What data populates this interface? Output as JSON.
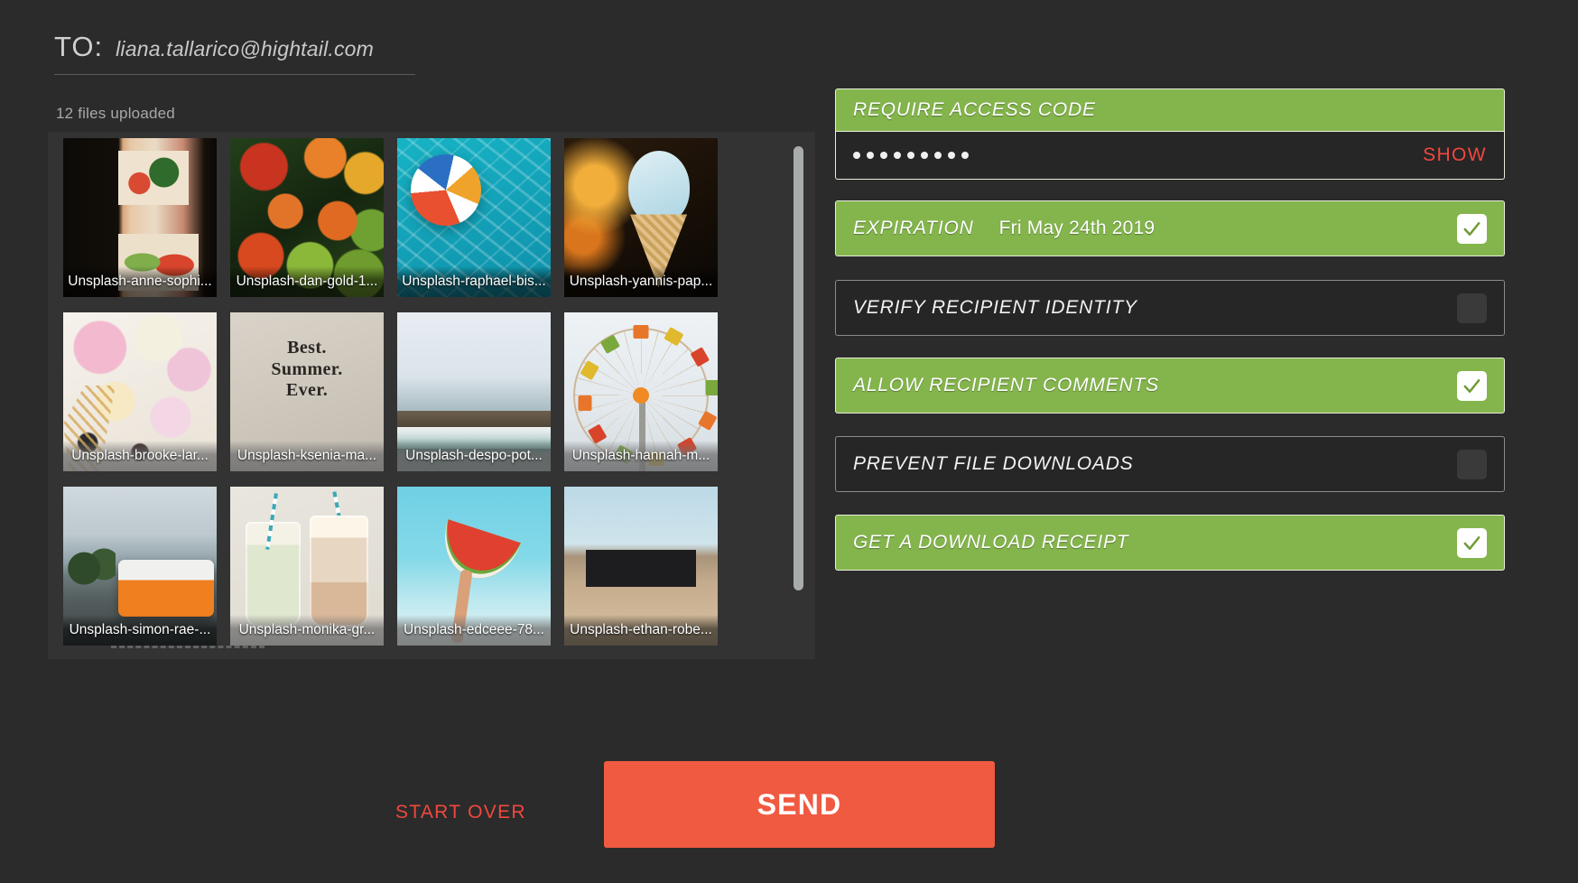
{
  "recipient": {
    "label": "TO:",
    "email": "liana.tallarico@hightail.com"
  },
  "files": {
    "count_text": "12 files uploaded",
    "rows": [
      [
        {
          "caption": "Unsplash-anne-sophi...",
          "art": "a1",
          "tone": "dark"
        },
        {
          "caption": "Unsplash-dan-gold-1...",
          "art": "a2",
          "tone": "dark"
        },
        {
          "caption": "Unsplash-raphael-bis...",
          "art": "a3",
          "tone": "dark"
        },
        {
          "caption": "Unsplash-yannis-pap...",
          "art": "a4",
          "tone": "dark"
        }
      ],
      [
        {
          "caption": "Unsplash-brooke-lar...",
          "art": "a5",
          "tone": "light"
        },
        {
          "caption": "Unsplash-ksenia-ma...",
          "art": "a6",
          "tone": "light"
        },
        {
          "caption": "Unsplash-despo-pot...",
          "art": "a7",
          "tone": "light"
        },
        {
          "caption": "Unsplash-hannah-m...",
          "art": "a8",
          "tone": "light"
        }
      ],
      [
        {
          "caption": "Unsplash-simon-rae-...",
          "art": "a9",
          "tone": "dark"
        },
        {
          "caption": "Unsplash-monika-gr...",
          "art": "a10",
          "tone": "light"
        },
        {
          "caption": "Unsplash-edceee-78...",
          "art": "a11",
          "tone": "light"
        },
        {
          "caption": "Unsplash-ethan-robe...",
          "art": "a12",
          "tone": "dark"
        }
      ]
    ],
    "poster_text": {
      "line1": "Best.",
      "line2": "Summer.",
      "line3": "Ever."
    }
  },
  "options": {
    "access_code": {
      "label": "REQUIRE ACCESS CODE",
      "enabled": true,
      "masked_length": 9,
      "show_label": "SHOW"
    },
    "rows": [
      {
        "label": "EXPIRATION",
        "value": "Fri May 24th 2019",
        "enabled": true
      },
      {
        "label": "VERIFY RECIPIENT IDENTITY",
        "value": "",
        "enabled": false
      },
      {
        "label": "ALLOW RECIPIENT COMMENTS",
        "value": "",
        "enabled": true
      },
      {
        "label": "PREVENT FILE DOWNLOADS",
        "value": "",
        "enabled": false
      },
      {
        "label": "GET A DOWNLOAD RECEIPT",
        "value": "",
        "enabled": true
      }
    ]
  },
  "actions": {
    "start_over": "START OVER",
    "send": "SEND"
  },
  "colors": {
    "accent_green": "#84b54c",
    "accent_red": "#f0483e",
    "send_button": "#f05a41",
    "background": "#2b2b2b",
    "panel": "#333333"
  }
}
